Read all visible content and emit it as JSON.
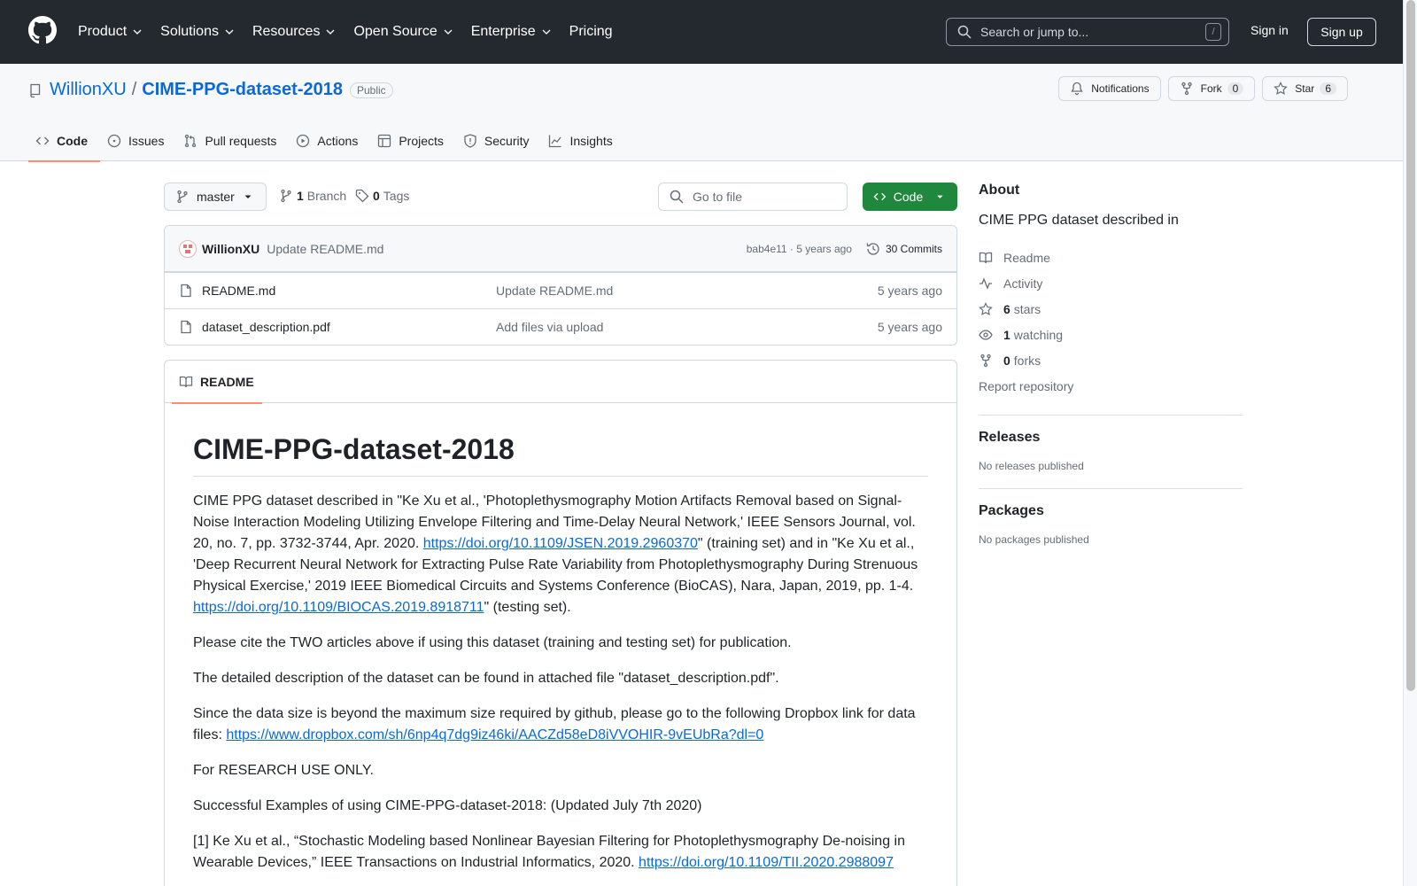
{
  "header": {
    "nav": [
      "Product",
      "Solutions",
      "Resources",
      "Open Source",
      "Enterprise",
      "Pricing"
    ],
    "search_placeholder": "Search or jump to...",
    "search_shortcut": "/",
    "sign_in": "Sign in",
    "sign_up": "Sign up"
  },
  "repo": {
    "owner": "WillionXU",
    "separator": "/",
    "name": "CIME-PPG-dataset-2018",
    "visibility": "Public",
    "notifications_label": "Notifications",
    "fork_label": "Fork",
    "fork_count": "0",
    "star_label": "Star",
    "star_count": "6"
  },
  "tabs": [
    "Code",
    "Issues",
    "Pull requests",
    "Actions",
    "Projects",
    "Security",
    "Insights"
  ],
  "branch": {
    "current": "master",
    "branch_count": "1",
    "branch_label": "Branch",
    "tag_count": "0",
    "tag_label": "Tags",
    "goto_placeholder": "Go to file",
    "code_button": "Code"
  },
  "commit": {
    "author": "WillionXU",
    "message": "Update README.md",
    "hash": "bab4e11",
    "dot": "·",
    "time": "5 years ago",
    "commits_label": "30 Commits"
  },
  "files": [
    {
      "name": "README.md",
      "message": "Update README.md",
      "date": "5 years ago"
    },
    {
      "name": "dataset_description.pdf",
      "message": "Add files via upload",
      "date": "5 years ago"
    }
  ],
  "readme": {
    "tab_label": "README",
    "title": "CIME-PPG-dataset-2018",
    "p1_a": "CIME PPG dataset described in \"Ke Xu et al., 'Photoplethysmography Motion Artifacts Removal based on Signal-Noise Interaction Modeling Utilizing Envelope Filtering and Time-Delay Neural Network,' IEEE Sensors Journal, vol. 20, no. 7, pp. 3732-3744, Apr. 2020. ",
    "p1_link1": "https://doi.org/10.1109/JSEN.2019.2960370",
    "p1_b": "\" (training set) and in \"Ke Xu et al., 'Deep Recurrent Neural Network for Extracting Pulse Rate Variability from Photoplethysmography During Strenuous Physical Exercise,' 2019 IEEE Biomedical Circuits and Systems Conference (BioCAS), Nara, Japan, 2019, pp. 1-4. ",
    "p1_link2": "https://doi.org/10.1109/BIOCAS.2019.8918711",
    "p1_c": "\" (testing set).",
    "p2": "Please cite the TWO articles above if using this dataset (training and testing set) for publication.",
    "p3": "The detailed description of the dataset can be found in attached file \"dataset_description.pdf\".",
    "p4_a": "Since the data size is beyond the maximum size required by github, please go to the following Dropbox link for data files: ",
    "p4_link": "https://www.dropbox.com/sh/6np4q7dg9iz46ki/AACZd58eD8iVVOHIR-9vEUbRa?dl=0",
    "p5": "For RESEARCH USE ONLY.",
    "p6": "Successful Examples of using CIME-PPG-dataset-2018: (Updated July 7th 2020)",
    "p7_a": "[1] Ke Xu et al., “Stochastic Modeling based Nonlinear Bayesian Filtering for Photoplethysmography De-noising in Wearable Devices,” IEEE Transactions on Industrial Informatics, 2020. ",
    "p7_link": "https://doi.org/10.1109/TII.2020.2988097"
  },
  "about": {
    "heading": "About",
    "description": "CIME PPG dataset described in",
    "readme": "Readme",
    "activity": "Activity",
    "stars_count": "6",
    "stars_label": "stars",
    "watching_count": "1",
    "watching_label": "watching",
    "forks_count": "0",
    "forks_label": "forks",
    "report": "Report repository"
  },
  "releases": {
    "heading": "Releases",
    "empty": "No releases published"
  },
  "packages": {
    "heading": "Packages",
    "empty": "No packages published"
  },
  "colors": {
    "header_bg": "#24292f",
    "link": "#0969da",
    "primary_button": "#1f883d",
    "tab_underline": "#fd8c73"
  }
}
